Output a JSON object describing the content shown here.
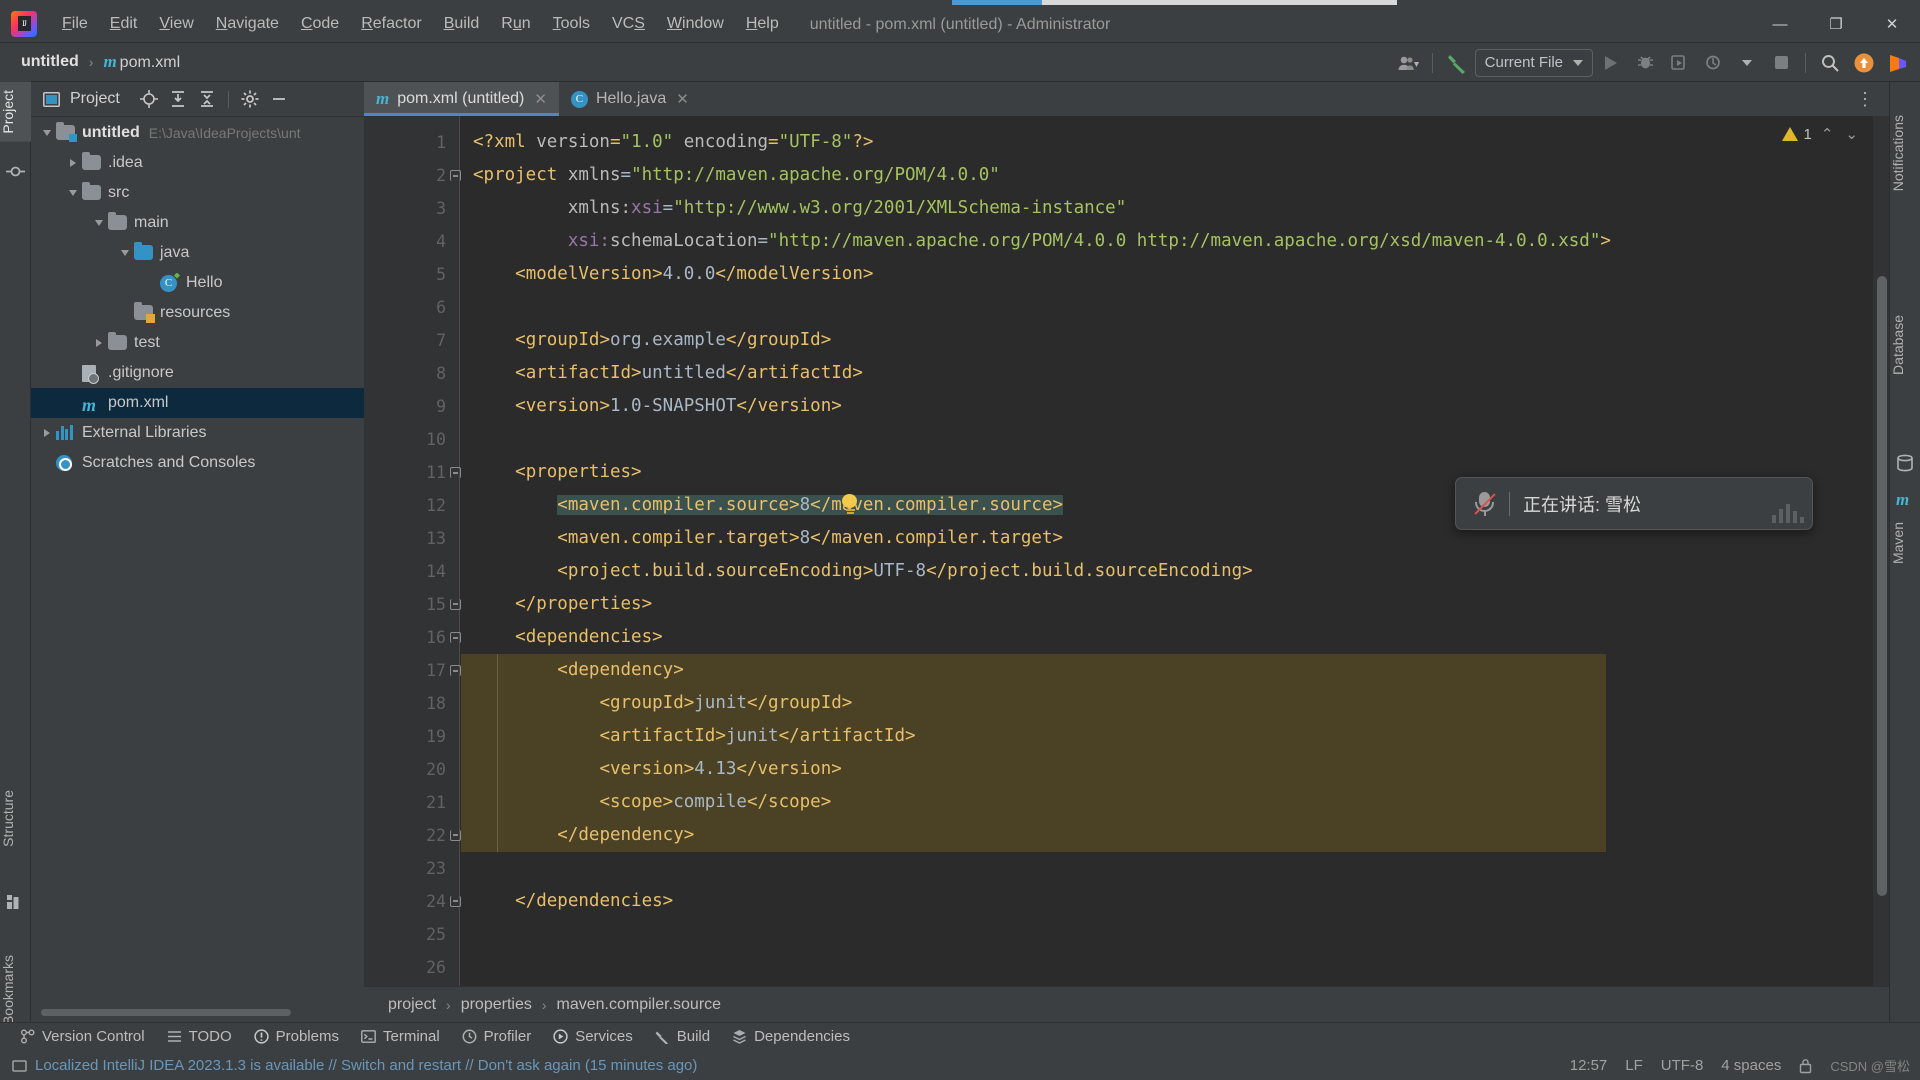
{
  "window": {
    "title": "untitled - pom.xml (untitled) - Administrator",
    "minimize": "—",
    "maximize": "❐",
    "close": "✕"
  },
  "menubar": {
    "items": [
      {
        "pre": "",
        "mn": "F",
        "post": "ile"
      },
      {
        "pre": "",
        "mn": "E",
        "post": "dit"
      },
      {
        "pre": "",
        "mn": "V",
        "post": "iew"
      },
      {
        "pre": "",
        "mn": "N",
        "post": "avigate"
      },
      {
        "pre": "",
        "mn": "C",
        "post": "ode"
      },
      {
        "pre": "",
        "mn": "R",
        "post": "efactor"
      },
      {
        "pre": "",
        "mn": "B",
        "post": "uild"
      },
      {
        "pre": "R",
        "mn": "u",
        "post": "n"
      },
      {
        "pre": "",
        "mn": "T",
        "post": "ools"
      },
      {
        "pre": "VC",
        "mn": "S",
        "post": ""
      },
      {
        "pre": "",
        "mn": "W",
        "post": "indow"
      },
      {
        "pre": "",
        "mn": "H",
        "post": "elp"
      }
    ]
  },
  "navbar": {
    "crumbs": [
      "untitled",
      "pom.xml"
    ],
    "maven_badge": "m",
    "separator": "›",
    "run_config": "Current File",
    "icons": [
      "user-account-icon",
      "build-hammer-icon",
      "run-icon",
      "debug-icon",
      "run-with-coverage-icon",
      "profiler-icon",
      "stop-icon",
      "search-everywhere-icon",
      "updates-icon",
      "plugin-icon"
    ]
  },
  "left_strip": {
    "top_tab": "Project",
    "bottom_tabs": [
      "Structure",
      "Bookmarks"
    ]
  },
  "right_strip": {
    "tabs": [
      "Notifications",
      "Database",
      "Maven"
    ]
  },
  "project_panel": {
    "title": "Project",
    "header_icons": [
      "locate-icon",
      "expand-all-icon",
      "collapse-all-icon",
      "settings-gear-icon",
      "hide-icon"
    ],
    "tree": [
      {
        "indent": 0,
        "arrow": "down",
        "icon": "module-folder-icon",
        "label": "untitled",
        "bold": true,
        "path": "E:\\Java\\IdeaProjects\\unt",
        "selected": false
      },
      {
        "indent": 1,
        "arrow": "right",
        "icon": "folder-icon",
        "label": ".idea",
        "bold": false,
        "path": "",
        "selected": false
      },
      {
        "indent": 1,
        "arrow": "down",
        "icon": "folder-icon",
        "label": "src",
        "bold": false,
        "path": "",
        "selected": false
      },
      {
        "indent": 2,
        "arrow": "down",
        "icon": "folder-icon",
        "label": "main",
        "bold": false,
        "path": "",
        "selected": false
      },
      {
        "indent": 3,
        "arrow": "down",
        "icon": "source-folder-icon",
        "label": "java",
        "bold": false,
        "path": "",
        "selected": false
      },
      {
        "indent": 4,
        "arrow": "none",
        "icon": "java-class-icon",
        "label": "Hello",
        "bold": false,
        "path": "",
        "selected": false
      },
      {
        "indent": 3,
        "arrow": "none",
        "icon": "resources-folder-icon",
        "label": "resources",
        "bold": false,
        "path": "",
        "selected": false
      },
      {
        "indent": 2,
        "arrow": "right",
        "icon": "folder-icon",
        "label": "test",
        "bold": false,
        "path": "",
        "selected": false
      },
      {
        "indent": 1,
        "arrow": "none",
        "icon": "gitignore-file-icon",
        "label": ".gitignore",
        "bold": false,
        "path": "",
        "selected": false
      },
      {
        "indent": 1,
        "arrow": "none",
        "icon": "maven-pom-icon",
        "label": "pom.xml",
        "bold": false,
        "path": "",
        "selected": true
      },
      {
        "indent": 0,
        "arrow": "right",
        "icon": "external-libraries-icon",
        "label": "External Libraries",
        "bold": false,
        "path": "",
        "selected": false
      },
      {
        "indent": 0,
        "arrow": "none",
        "icon": "scratches-icon",
        "label": "Scratches and Consoles",
        "bold": false,
        "path": "",
        "selected": false
      }
    ]
  },
  "editor": {
    "tabs": [
      {
        "label": "pom.xml (untitled)",
        "icon": "maven-pom-icon",
        "active": true,
        "close": "✕"
      },
      {
        "label": "Hello.java",
        "icon": "java-class-icon",
        "active": false,
        "close": "✕"
      }
    ],
    "kebab": "⋮",
    "warning_count": "1",
    "warning_icon": "warning-triangle-icon",
    "chevron_up": "⌃",
    "chevron_down": "⌄",
    "line_numbers": [
      "1",
      "2",
      "3",
      "4",
      "5",
      "6",
      "7",
      "8",
      "9",
      "10",
      "11",
      "12",
      "13",
      "14",
      "15",
      "16",
      "17",
      "18",
      "19",
      "20",
      "21",
      "22",
      "23",
      "24",
      "25",
      "26"
    ],
    "breadcrumbs": [
      "project",
      "properties",
      "maven.compiler.source"
    ],
    "breadcrumb_sep": "›",
    "code": [
      {
        "n": 1,
        "indent": 0,
        "tokens": [
          {
            "t": "pi",
            "s": "<?xml "
          },
          {
            "t": "attr",
            "s": "version"
          },
          {
            "t": "pi",
            "s": "="
          },
          {
            "t": "val",
            "s": "\"1.0\""
          },
          {
            "t": "attr",
            "s": " encoding"
          },
          {
            "t": "pi",
            "s": "="
          },
          {
            "t": "val",
            "s": "\"UTF-8\""
          },
          {
            "t": "pi",
            "s": "?>"
          }
        ]
      },
      {
        "n": 2,
        "indent": 0,
        "tokens": [
          {
            "t": "tag",
            "s": "<project "
          },
          {
            "t": "attr",
            "s": "xmlns"
          },
          {
            "t": "txt",
            "s": "="
          },
          {
            "t": "val",
            "s": "\"http://maven.apache.org/POM/4.0.0\""
          }
        ]
      },
      {
        "n": 3,
        "indent": 0,
        "tokens": [
          {
            "t": "txt",
            "s": "         "
          },
          {
            "t": "attr",
            "s": "xmlns:"
          },
          {
            "t": "ns",
            "s": "xsi"
          },
          {
            "t": "txt",
            "s": "="
          },
          {
            "t": "val",
            "s": "\"http://www.w3.org/2001/XMLSchema-instance\""
          }
        ]
      },
      {
        "n": 4,
        "indent": 0,
        "tokens": [
          {
            "t": "txt",
            "s": "         "
          },
          {
            "t": "ns",
            "s": "xsi:"
          },
          {
            "t": "attr",
            "s": "schemaLocation"
          },
          {
            "t": "txt",
            "s": "="
          },
          {
            "t": "val",
            "s": "\"http://maven.apache.org/POM/4.0.0 http://maven.apache.org/xsd/maven-4.0.0.xsd\""
          },
          {
            "t": "tag",
            "s": ">"
          }
        ]
      },
      {
        "n": 5,
        "indent": 0,
        "tokens": [
          {
            "t": "txt",
            "s": "    "
          },
          {
            "t": "tag",
            "s": "<modelVersion>"
          },
          {
            "t": "txt",
            "s": "4.0.0"
          },
          {
            "t": "tag",
            "s": "</modelVersion>"
          }
        ]
      },
      {
        "n": 6,
        "indent": 0,
        "tokens": []
      },
      {
        "n": 7,
        "indent": 0,
        "tokens": [
          {
            "t": "txt",
            "s": "    "
          },
          {
            "t": "tag",
            "s": "<groupId>"
          },
          {
            "t": "txt",
            "s": "org.example"
          },
          {
            "t": "tag",
            "s": "</groupId>"
          }
        ]
      },
      {
        "n": 8,
        "indent": 0,
        "tokens": [
          {
            "t": "txt",
            "s": "    "
          },
          {
            "t": "tag",
            "s": "<artifactId>"
          },
          {
            "t": "txt",
            "s": "untitled"
          },
          {
            "t": "tag",
            "s": "</artifactId>"
          }
        ]
      },
      {
        "n": 9,
        "indent": 0,
        "tokens": [
          {
            "t": "txt",
            "s": "    "
          },
          {
            "t": "tag",
            "s": "<version>"
          },
          {
            "t": "txt",
            "s": "1.0-SNAPSHOT"
          },
          {
            "t": "tag",
            "s": "</version>"
          }
        ]
      },
      {
        "n": 10,
        "indent": 0,
        "tokens": []
      },
      {
        "n": 11,
        "indent": 0,
        "tokens": [
          {
            "t": "txt",
            "s": "    "
          },
          {
            "t": "tag",
            "s": "<properties>"
          }
        ]
      },
      {
        "n": 12,
        "indent": 0,
        "tokens": [
          {
            "t": "txt",
            "s": "        "
          },
          {
            "t": "tag hl-match",
            "s": "<maven.compiler.source>"
          },
          {
            "t": "txt hl-match",
            "s": "8"
          },
          {
            "t": "tag hl-match",
            "s": "</maven.compiler.source>"
          }
        ]
      },
      {
        "n": 13,
        "indent": 0,
        "tokens": [
          {
            "t": "txt",
            "s": "        "
          },
          {
            "t": "tag",
            "s": "<maven.compiler.target>"
          },
          {
            "t": "txt",
            "s": "8"
          },
          {
            "t": "tag",
            "s": "</maven.compiler.target>"
          }
        ]
      },
      {
        "n": 14,
        "indent": 0,
        "tokens": [
          {
            "t": "txt",
            "s": "        "
          },
          {
            "t": "tag",
            "s": "<project.build.sourceEncoding>"
          },
          {
            "t": "txt",
            "s": "UTF-8"
          },
          {
            "t": "tag",
            "s": "</project.build.sourceEncoding>"
          }
        ]
      },
      {
        "n": 15,
        "indent": 0,
        "tokens": [
          {
            "t": "txt",
            "s": "    "
          },
          {
            "t": "tag",
            "s": "</properties>"
          }
        ]
      },
      {
        "n": 16,
        "indent": 0,
        "tokens": [
          {
            "t": "txt",
            "s": "    "
          },
          {
            "t": "tag",
            "s": "<dependencies>"
          }
        ]
      },
      {
        "n": 17,
        "indent": 0,
        "tokens": [
          {
            "t": "txt",
            "s": "        "
          },
          {
            "t": "tag",
            "s": "<dependency>"
          }
        ]
      },
      {
        "n": 18,
        "indent": 0,
        "tokens": [
          {
            "t": "txt",
            "s": "            "
          },
          {
            "t": "tag",
            "s": "<groupId>"
          },
          {
            "t": "txt",
            "s": "junit"
          },
          {
            "t": "tag",
            "s": "</groupId>"
          }
        ]
      },
      {
        "n": 19,
        "indent": 0,
        "tokens": [
          {
            "t": "txt",
            "s": "            "
          },
          {
            "t": "tag",
            "s": "<artifactId>"
          },
          {
            "t": "txt",
            "s": "junit"
          },
          {
            "t": "tag",
            "s": "</artifactId>"
          }
        ]
      },
      {
        "n": 20,
        "indent": 0,
        "tokens": [
          {
            "t": "txt",
            "s": "            "
          },
          {
            "t": "tag",
            "s": "<version>"
          },
          {
            "t": "txt",
            "s": "4.13"
          },
          {
            "t": "tag",
            "s": "</version>"
          }
        ]
      },
      {
        "n": 21,
        "indent": 0,
        "tokens": [
          {
            "t": "txt",
            "s": "            "
          },
          {
            "t": "tag",
            "s": "<scope>"
          },
          {
            "t": "txt",
            "s": "compile"
          },
          {
            "t": "tag",
            "s": "</scope>"
          }
        ]
      },
      {
        "n": 22,
        "indent": 0,
        "tokens": [
          {
            "t": "txt",
            "s": "        "
          },
          {
            "t": "tag",
            "s": "</dependency>"
          }
        ]
      },
      {
        "n": 23,
        "indent": 0,
        "tokens": []
      },
      {
        "n": 24,
        "indent": 0,
        "tokens": [
          {
            "t": "txt",
            "s": "    "
          },
          {
            "t": "tag",
            "s": "</dependencies>"
          }
        ]
      },
      {
        "n": 25,
        "indent": 0,
        "tokens": []
      },
      {
        "n": 26,
        "indent": 0,
        "tokens": []
      }
    ]
  },
  "speech_popup": {
    "icon": "microphone-muted-icon",
    "text": "正在讲话: 雪松"
  },
  "bottom_bar": {
    "items": [
      {
        "label": "Version Control",
        "icon": "version-control-icon"
      },
      {
        "label": "TODO",
        "icon": "todo-icon"
      },
      {
        "label": "Problems",
        "icon": "problems-icon"
      },
      {
        "label": "Terminal",
        "icon": "terminal-icon"
      },
      {
        "label": "Profiler",
        "icon": "profiler-icon"
      },
      {
        "label": "Services",
        "icon": "services-icon"
      },
      {
        "label": "Build",
        "icon": "build-icon"
      },
      {
        "label": "Dependencies",
        "icon": "dependencies-icon"
      }
    ]
  },
  "statusbar": {
    "message": "Localized IntelliJ IDEA 2023.1.3 is available // Switch and restart // Don't ask again (15 minutes ago)",
    "time": "12:57",
    "line_sep": "LF",
    "encoding": "UTF-8",
    "indent": "4 spaces",
    "watermark": "CSDN @雪松",
    "lock_icon": "lock-icon",
    "event_icon": "event-log-icon"
  },
  "colors": {
    "accent_blue": "#4a88c7",
    "tag": "#e8bf6a",
    "string": "#a5c261",
    "namespace": "#9876aa",
    "text": "#a9b7c6",
    "selection_band": "#4b4226",
    "match_highlight": "#3b514d",
    "tree_selection": "#0d293e",
    "editor_bg": "#2b2b2b",
    "chrome_bg": "#3c3f41"
  }
}
